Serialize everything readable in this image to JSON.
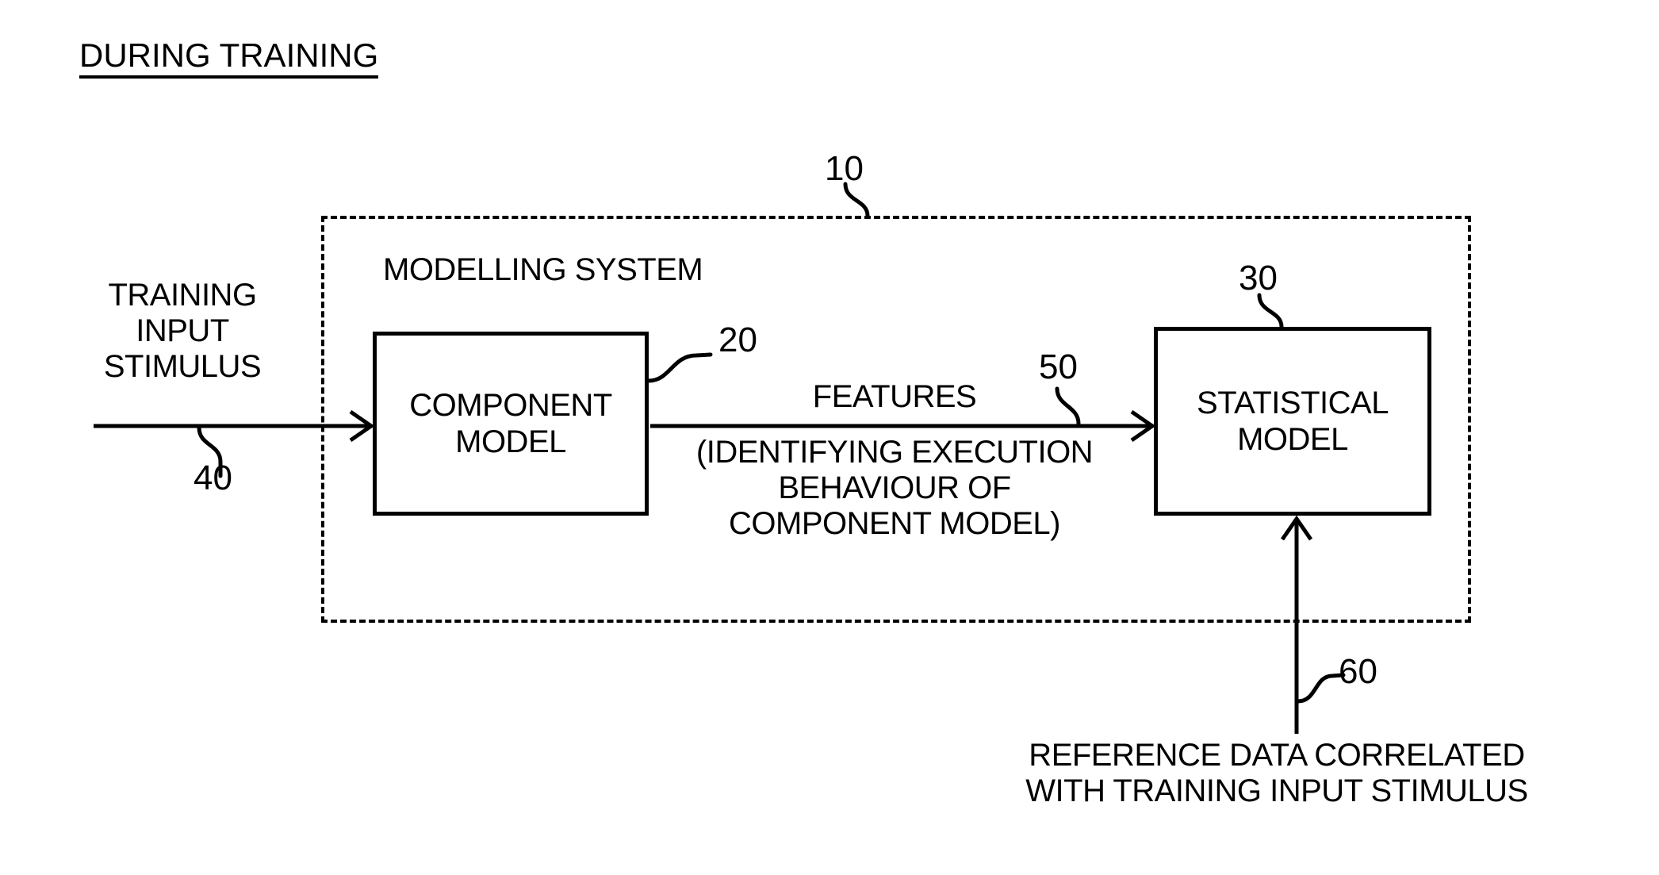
{
  "figure": {
    "heading": "DURING TRAINING",
    "background_color": "#ffffff",
    "line_color": "#000000"
  },
  "system_boundary": {
    "label": "MODELLING SYSTEM",
    "reference_numeral": "10",
    "style": "dashed"
  },
  "blocks": {
    "component_model": {
      "line1": "COMPONENT",
      "line2": "MODEL",
      "reference_numeral": "20"
    },
    "statistical_model": {
      "line1": "STATISTICAL",
      "line2": "MODEL",
      "reference_numeral": "30"
    }
  },
  "inputs": {
    "training_stimulus": {
      "line1": "TRAINING",
      "line2": "INPUT",
      "line3": "STIMULUS",
      "reference_numeral": "40"
    },
    "reference_data": {
      "line1": "REFERENCE DATA CORRELATED",
      "line2": "WITH TRAINING INPUT STIMULUS",
      "reference_numeral": "60"
    }
  },
  "signals": {
    "features": {
      "title": "FEATURES",
      "detail_line1": "(IDENTIFYING EXECUTION",
      "detail_line2": "BEHAVIOUR OF",
      "detail_line3": "COMPONENT MODEL)",
      "reference_numeral": "50"
    }
  }
}
